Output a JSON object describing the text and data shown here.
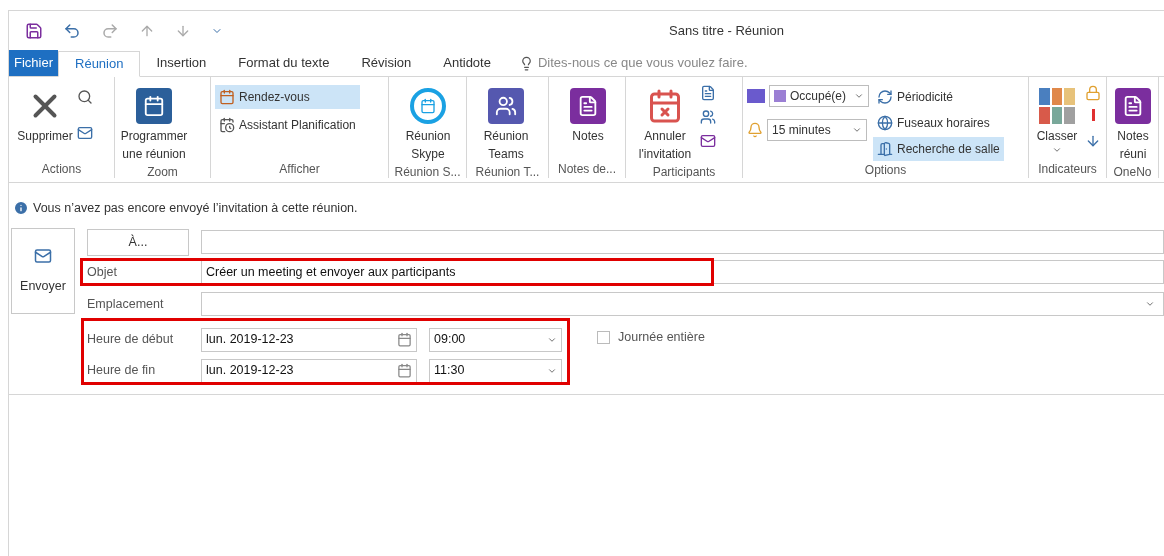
{
  "window": {
    "title": "Sans titre - Réunion"
  },
  "tabs": [
    {
      "label": "Fichier",
      "kind": "file",
      "selected": false
    },
    {
      "label": "Réunion",
      "kind": "tab",
      "selected": true
    },
    {
      "label": "Insertion",
      "kind": "tab",
      "selected": false
    },
    {
      "label": "Format du texte",
      "kind": "tab",
      "selected": false
    },
    {
      "label": "Révision",
      "kind": "tab",
      "selected": false
    },
    {
      "label": "Antidote",
      "kind": "tab",
      "selected": false
    }
  ],
  "tell_me": {
    "placeholder": "Dites-nous ce que vous voulez faire."
  },
  "ribbon": {
    "groups": [
      {
        "label": "Actions",
        "items": [
          {
            "kind": "large",
            "label": "Supprimer"
          }
        ]
      },
      {
        "label": "Zoom",
        "items": [
          {
            "kind": "large",
            "label": "Programmer une réunion"
          }
        ]
      },
      {
        "label": "Afficher",
        "items": [
          {
            "kind": "small",
            "label": "Rendez-vous",
            "selected": true
          },
          {
            "kind": "small",
            "label": "Assistant Planification",
            "selected": false
          }
        ]
      },
      {
        "label": "Réunion S...",
        "items": [
          {
            "kind": "large",
            "label": "Réunion Skype"
          }
        ]
      },
      {
        "label": "Réunion T...",
        "items": [
          {
            "kind": "large",
            "label": "Réunion Teams"
          }
        ]
      },
      {
        "label": "Notes de...",
        "items": [
          {
            "kind": "large",
            "label": "Notes"
          }
        ]
      },
      {
        "label": "Participants",
        "items": [
          {
            "kind": "large",
            "label": "Annuler l'invitation"
          }
        ]
      },
      {
        "label": "Options",
        "items": [
          {
            "kind": "dropdown",
            "value": "Occupé(e)",
            "color": "#9b7fd4"
          },
          {
            "kind": "dropdown",
            "value": "15 minutes"
          },
          {
            "kind": "small",
            "label": "Périodicité",
            "selected": false
          },
          {
            "kind": "small",
            "label": "Fuseaux horaires",
            "selected": false
          },
          {
            "kind": "small",
            "label": "Recherche de salle",
            "selected": true
          }
        ]
      },
      {
        "label": "Indicateurs",
        "items": [
          {
            "kind": "large",
            "label": "Classer"
          }
        ]
      },
      {
        "label": "OneNo",
        "items": [
          {
            "kind": "large",
            "label": "Notes réuni"
          }
        ]
      }
    ]
  },
  "info": {
    "message": "Vous n’avez pas encore envoyé l’invitation à cette réunion."
  },
  "form": {
    "send_button": "Envoyer",
    "to_button": "À...",
    "subject": {
      "label": "Objet",
      "value": "Créer un meeting et envoyer aux participants",
      "highlighted": true
    },
    "location": {
      "label": "Emplacement"
    },
    "schedule": {
      "highlighted": true,
      "rows": [
        {
          "label": "Heure de début",
          "date": "lun. 2019-12-23",
          "time": "09:00"
        },
        {
          "label": "Heure de fin",
          "date": "lun. 2019-12-23",
          "time": "11:30"
        }
      ]
    },
    "all_day": {
      "label": "Journée entière",
      "checked": false
    }
  }
}
